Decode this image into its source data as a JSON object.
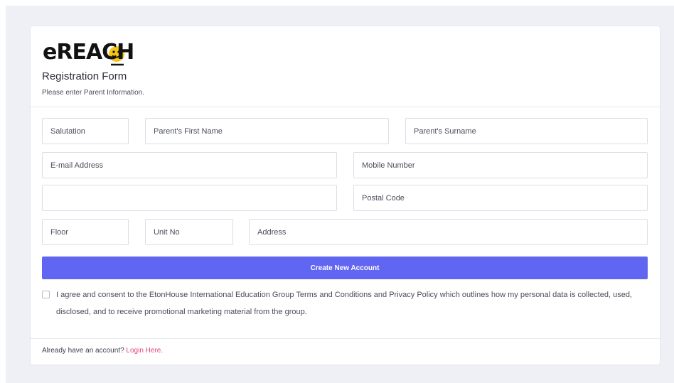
{
  "brand": {
    "logo_text": "eREACH",
    "accent_color": "#6066f2",
    "logo_yellow": "#f5c518"
  },
  "header": {
    "title": "Registration Form",
    "subtitle": "Please enter Parent Information."
  },
  "form": {
    "salutation_placeholder": "Salutation",
    "first_name_placeholder": "Parent's First Name",
    "surname_placeholder": "Parent's Surname",
    "email_placeholder": "E-mail Address",
    "mobile_placeholder": "Mobile Number",
    "blank_field_value": "",
    "postal_placeholder": "Postal Code",
    "floor_placeholder": "Floor",
    "unit_placeholder": "Unit No",
    "address_placeholder": "Address",
    "submit_label": "Create New Account",
    "consent_text": "I agree and consent to the EtonHouse International Education Group Terms and Conditions and Privacy Policy which outlines how my personal data is collected, used, disclosed, and to receive promotional marketing material from the group.",
    "consent_checked": false
  },
  "footer": {
    "prompt": "Already have an account?",
    "login_label": "Login Here."
  }
}
